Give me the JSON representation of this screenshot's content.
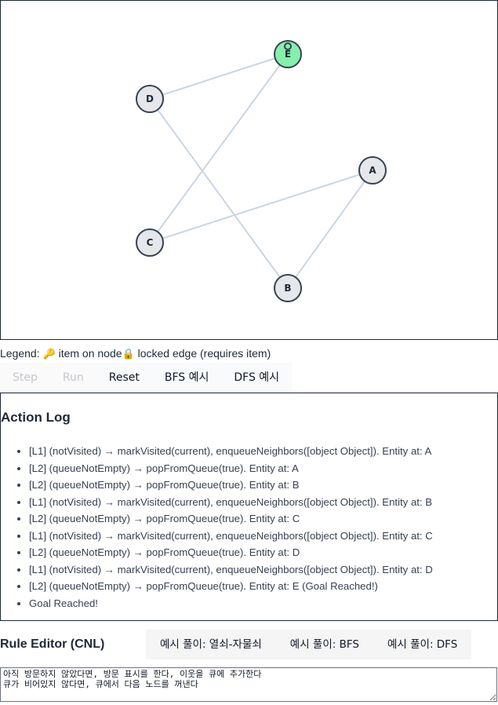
{
  "graph": {
    "nodes": [
      {
        "id": "E",
        "label": "E",
        "goal": true,
        "has_item": true
      },
      {
        "id": "D",
        "label": "D",
        "goal": false,
        "has_item": false
      },
      {
        "id": "A",
        "label": "A",
        "goal": false,
        "has_item": false
      },
      {
        "id": "C",
        "label": "C",
        "goal": false,
        "has_item": false
      },
      {
        "id": "B",
        "label": "B",
        "goal": false,
        "has_item": false
      }
    ],
    "edges": [
      {
        "from": "D",
        "to": "E"
      },
      {
        "from": "C",
        "to": "E"
      },
      {
        "from": "D",
        "to": "B"
      },
      {
        "from": "C",
        "to": "A"
      },
      {
        "from": "A",
        "to": "B"
      }
    ],
    "colors": {
      "goal_node": "#86efac",
      "node": "#e5e7eb",
      "edge": "#cbd5e1",
      "item_marker": "#a21caf"
    }
  },
  "legend": {
    "prefix": "Legend:",
    "item_icon": "🔑",
    "item_text": "item on node",
    "lock_icon": "🔒",
    "lock_text": "locked edge (requires item)"
  },
  "controls": {
    "step": "Step",
    "run": "Run",
    "reset": "Reset",
    "bfs_example": "BFS 예시",
    "dfs_example": "DFS 예시"
  },
  "action_log": {
    "title": "Action Log",
    "entries": [
      "[L1] (notVisited) → markVisited(current), enqueueNeighbors([object Object]). Entity at: A",
      "[L2] (queueNotEmpty) → popFromQueue(true). Entity at: A",
      "[L2] (queueNotEmpty) → popFromQueue(true). Entity at: B",
      "[L1] (notVisited) → markVisited(current), enqueueNeighbors([object Object]). Entity at: B",
      "[L2] (queueNotEmpty) → popFromQueue(true). Entity at: C",
      "[L1] (notVisited) → markVisited(current), enqueueNeighbors([object Object]). Entity at: C",
      "[L2] (queueNotEmpty) → popFromQueue(true). Entity at: D",
      "[L1] (notVisited) → markVisited(current), enqueueNeighbors([object Object]). Entity at: D",
      "[L2] (queueNotEmpty) → popFromQueue(true). Entity at: E (Goal Reached!)",
      "Goal Reached!"
    ]
  },
  "rule_editor": {
    "title": "Rule Editor (CNL)",
    "example_key_item": "예시 풀이: 열쇠-자물쇠",
    "example_bfs": "예시 풀이: BFS",
    "example_dfs": "예시 풀이: DFS",
    "content": "아직 방문하지 않았다면, 방문 표시를 한다, 이웃을 큐에 추가한다\n큐가 비어있지 않다면, 큐에서 다음 노드를 꺼낸다"
  }
}
